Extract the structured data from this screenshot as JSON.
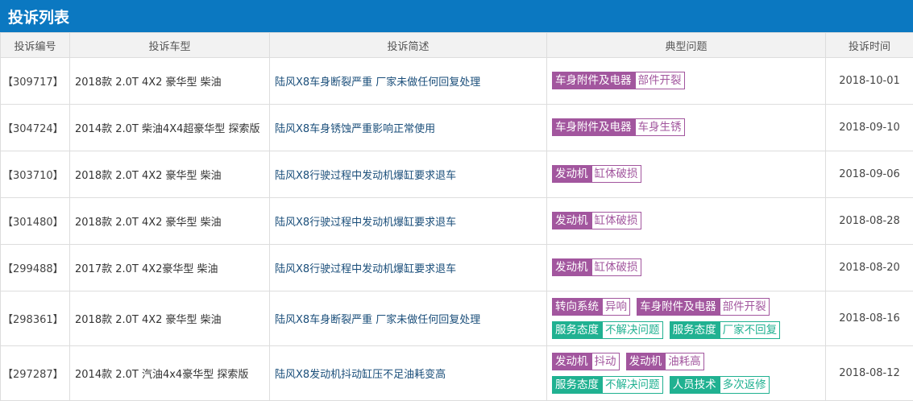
{
  "title": "投诉列表",
  "headers": [
    "投诉编号",
    "投诉车型",
    "投诉简述",
    "典型问题",
    "投诉时间"
  ],
  "colors": {
    "header": "#0b78c1",
    "purple": "#a2569e",
    "teal": "#20b191"
  },
  "rows": [
    {
      "id": "【309717】",
      "model": "2018款 2.0T 4X2 豪华型 柴油",
      "desc": "陆风X8车身断裂严重 厂家未做任何回复处理",
      "tags": [
        {
          "c": "purple",
          "a": "车身附件及电器",
          "b": "部件开裂"
        }
      ],
      "date": "2018-10-01"
    },
    {
      "id": "【304724】",
      "model": "2014款 2.0T 柴油4X4超豪华型 探索版",
      "desc": "陆风X8车身锈蚀严重影响正常使用",
      "tags": [
        {
          "c": "purple",
          "a": "车身附件及电器",
          "b": "车身生锈"
        }
      ],
      "date": "2018-09-10"
    },
    {
      "id": "【303710】",
      "model": "2018款 2.0T 4X2 豪华型 柴油",
      "desc": "陆风X8行驶过程中发动机爆缸要求退车",
      "tags": [
        {
          "c": "purple",
          "a": "发动机",
          "b": "缸体破损"
        }
      ],
      "date": "2018-09-06"
    },
    {
      "id": "【301480】",
      "model": "2018款 2.0T 4X2 豪华型 柴油",
      "desc": "陆风X8行驶过程中发动机爆缸要求退车",
      "tags": [
        {
          "c": "purple",
          "a": "发动机",
          "b": "缸体破损"
        }
      ],
      "date": "2018-08-28"
    },
    {
      "id": "【299488】",
      "model": "2017款 2.0T 4X2豪华型 柴油",
      "desc": "陆风X8行驶过程中发动机爆缸要求退车",
      "tags": [
        {
          "c": "purple",
          "a": "发动机",
          "b": "缸体破损"
        }
      ],
      "date": "2018-08-20"
    },
    {
      "id": "【298361】",
      "model": "2018款 2.0T 4X2 豪华型 柴油",
      "desc": "陆风X8车身断裂严重 厂家未做任何回复处理",
      "tags": [
        {
          "c": "purple",
          "a": "转向系统",
          "b": "异响"
        },
        {
          "c": "purple",
          "a": "车身附件及电器",
          "b": "部件开裂"
        },
        {
          "c": "teal",
          "a": "服务态度",
          "b": "不解决问题"
        },
        {
          "c": "teal",
          "a": "服务态度",
          "b": "厂家不回复"
        }
      ],
      "date": "2018-08-16"
    },
    {
      "id": "【297287】",
      "model": "2014款 2.0T 汽油4x4豪华型 探索版",
      "desc": "陆风X8发动机抖动缸压不足油耗变高",
      "tags": [
        {
          "c": "purple",
          "a": "发动机",
          "b": "抖动"
        },
        {
          "c": "purple",
          "a": "发动机",
          "b": "油耗高"
        },
        {
          "c": "teal",
          "a": "服务态度",
          "b": "不解决问题"
        },
        {
          "c": "teal",
          "a": "人员技术",
          "b": "多次返修"
        }
      ],
      "date": "2018-08-12"
    }
  ]
}
